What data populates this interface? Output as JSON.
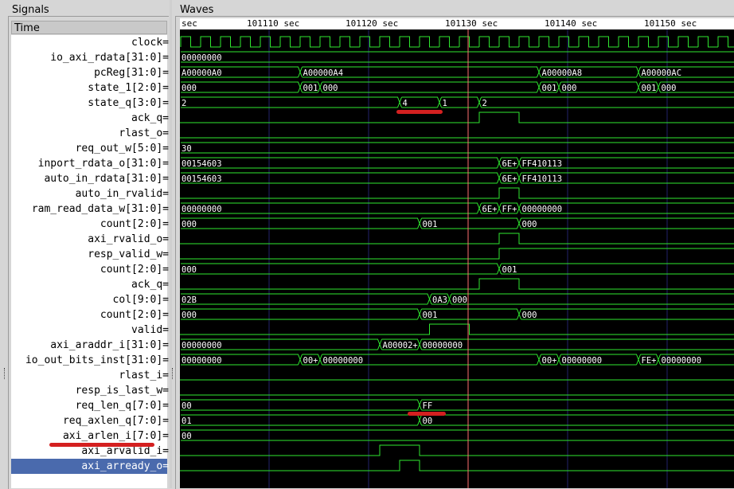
{
  "signals_panel": {
    "title": "Signals",
    "time_header": "Time"
  },
  "waves_panel": {
    "title": "Waves",
    "timeline_labels": [
      "sec",
      "101110 sec",
      "101120 sec",
      "101130 sec",
      "101140 sec",
      "101150 sec"
    ]
  },
  "signals": [
    {
      "name": "clock",
      "width": "",
      "suffix": "="
    },
    {
      "name": "io_axi_rdata",
      "width": "[31:0]",
      "suffix": "="
    },
    {
      "name": "pcReg",
      "width": "[31:0]",
      "suffix": "="
    },
    {
      "name": "state_1",
      "width": "[2:0]",
      "suffix": "="
    },
    {
      "name": "state_q",
      "width": "[3:0]",
      "suffix": "="
    },
    {
      "name": "ack_q",
      "width": "",
      "suffix": "="
    },
    {
      "name": "rlast_o",
      "width": "",
      "suffix": "="
    },
    {
      "name": "req_out_w",
      "width": "[5:0]",
      "suffix": "="
    },
    {
      "name": "inport_rdata_o",
      "width": "[31:0]",
      "suffix": "="
    },
    {
      "name": "auto_in_rdata",
      "width": "[31:0]",
      "suffix": "="
    },
    {
      "name": "auto_in_rvalid",
      "width": "",
      "suffix": "="
    },
    {
      "name": "ram_read_data_w",
      "width": "[31:0]",
      "suffix": "="
    },
    {
      "name": "count",
      "width": "[2:0]",
      "suffix": "="
    },
    {
      "name": "axi_rvalid_o",
      "width": "",
      "suffix": "="
    },
    {
      "name": "resp_valid_w",
      "width": "",
      "suffix": "="
    },
    {
      "name": "count",
      "width": "[2:0]",
      "suffix": "="
    },
    {
      "name": "ack_q",
      "width": "",
      "suffix": "="
    },
    {
      "name": "col",
      "width": "[9:0]",
      "suffix": "="
    },
    {
      "name": "count",
      "width": "[2:0]",
      "suffix": "="
    },
    {
      "name": "valid",
      "width": "",
      "suffix": "="
    },
    {
      "name": "axi_araddr_i",
      "width": "[31:0]",
      "suffix": "="
    },
    {
      "name": "io_out_bits_inst",
      "width": "[31:0]",
      "suffix": "="
    },
    {
      "name": "rlast_i",
      "width": "",
      "suffix": "="
    },
    {
      "name": "resp_is_last_w",
      "width": "",
      "suffix": "="
    },
    {
      "name": "req_len_q",
      "width": "[7:0]",
      "suffix": "="
    },
    {
      "name": "req_axlen_q",
      "width": "[7:0]",
      "suffix": "="
    },
    {
      "name": "axi_arlen_i",
      "width": "[7:0]",
      "suffix": "="
    },
    {
      "name": "axi_arvalid_i",
      "width": "",
      "suffix": "="
    },
    {
      "name": "axi_arready_o",
      "width": "",
      "suffix": "=",
      "selected": true
    }
  ],
  "waveforms": [
    {
      "kind": "clock",
      "period": 4
    },
    {
      "kind": "bus",
      "segments": [
        [
          0,
          112,
          "00000000"
        ]
      ]
    },
    {
      "kind": "bus",
      "segments": [
        [
          0,
          24,
          "A00000A0"
        ],
        [
          24,
          72,
          "A00000A4"
        ],
        [
          72,
          92,
          "A00000A8"
        ],
        [
          92,
          112,
          "A00000AC"
        ]
      ]
    },
    {
      "kind": "bus",
      "segments": [
        [
          0,
          24,
          "000"
        ],
        [
          24,
          28,
          "001"
        ],
        [
          28,
          72,
          "000"
        ],
        [
          72,
          76,
          "001"
        ],
        [
          76,
          92,
          "000"
        ],
        [
          92,
          96,
          "001"
        ],
        [
          96,
          112,
          "000"
        ]
      ]
    },
    {
      "kind": "bus",
      "segments": [
        [
          0,
          44,
          "2"
        ],
        [
          44,
          52,
          "4"
        ],
        [
          52,
          60,
          "1"
        ],
        [
          60,
          112,
          "2"
        ]
      ]
    },
    {
      "kind": "bit",
      "value_low": 0,
      "pulses": [
        [
          60,
          68
        ]
      ]
    },
    {
      "kind": "bit",
      "pulses": []
    },
    {
      "kind": "bus",
      "segments": [
        [
          0,
          112,
          "30"
        ]
      ]
    },
    {
      "kind": "bus",
      "segments": [
        [
          0,
          64,
          "00154603"
        ],
        [
          64,
          68,
          "6E+"
        ],
        [
          68,
          112,
          "FF410113"
        ]
      ]
    },
    {
      "kind": "bus",
      "segments": [
        [
          0,
          64,
          "00154603"
        ],
        [
          64,
          68,
          "6E+"
        ],
        [
          68,
          112,
          "FF410113"
        ]
      ]
    },
    {
      "kind": "bit",
      "pulses": [
        [
          64,
          68
        ]
      ]
    },
    {
      "kind": "bus",
      "segments": [
        [
          0,
          60,
          "00000000"
        ],
        [
          60,
          64,
          "6E+"
        ],
        [
          64,
          68,
          "FF+"
        ],
        [
          68,
          112,
          "00000000"
        ]
      ]
    },
    {
      "kind": "bus",
      "segments": [
        [
          0,
          48,
          "000"
        ],
        [
          48,
          68,
          "001"
        ],
        [
          68,
          112,
          "000"
        ]
      ]
    },
    {
      "kind": "bit",
      "pulses": [
        [
          64,
          68
        ]
      ]
    },
    {
      "kind": "bit",
      "value_from": 64
    },
    {
      "kind": "bus",
      "segments": [
        [
          0,
          64,
          "000"
        ],
        [
          64,
          112,
          "001"
        ]
      ]
    },
    {
      "kind": "bit",
      "pulses": [
        [
          60,
          68
        ]
      ]
    },
    {
      "kind": "bus",
      "segments": [
        [
          0,
          50,
          "02B"
        ],
        [
          50,
          54,
          "0A3"
        ],
        [
          54,
          112,
          "000"
        ]
      ]
    },
    {
      "kind": "bus",
      "segments": [
        [
          0,
          48,
          "000"
        ],
        [
          48,
          68,
          "001"
        ],
        [
          68,
          112,
          "000"
        ]
      ]
    },
    {
      "kind": "bit",
      "pulses": [
        [
          50,
          58
        ]
      ]
    },
    {
      "kind": "bus",
      "segments": [
        [
          0,
          40,
          "00000000"
        ],
        [
          40,
          48,
          "A00002+"
        ],
        [
          48,
          112,
          "00000000"
        ]
      ]
    },
    {
      "kind": "bus",
      "segments": [
        [
          0,
          24,
          "00000000"
        ],
        [
          24,
          28,
          "00+"
        ],
        [
          28,
          72,
          "00000000"
        ],
        [
          72,
          76,
          "00+"
        ],
        [
          76,
          92,
          "00000000"
        ],
        [
          92,
          96,
          "FE+"
        ],
        [
          96,
          112,
          "00000000"
        ]
      ]
    },
    {
      "kind": "bit",
      "pulses": []
    },
    {
      "kind": "bit",
      "pulses": []
    },
    {
      "kind": "bus",
      "segments": [
        [
          0,
          48,
          "00"
        ],
        [
          48,
          112,
          "FF"
        ]
      ]
    },
    {
      "kind": "bus",
      "segments": [
        [
          0,
          48,
          "01"
        ],
        [
          48,
          112,
          "00"
        ]
      ]
    },
    {
      "kind": "bus",
      "segments": [
        [
          0,
          112,
          "00"
        ]
      ]
    },
    {
      "kind": "bit",
      "pulses": [
        [
          40,
          48
        ]
      ]
    },
    {
      "kind": "bit",
      "pulses": [
        [
          44,
          48
        ]
      ]
    }
  ],
  "colors": {
    "wave": "#2fe82f",
    "grid": "#22226a",
    "cursor": "#ff7070",
    "annotation": "#d42020",
    "selected_row": "#4a6aad"
  }
}
